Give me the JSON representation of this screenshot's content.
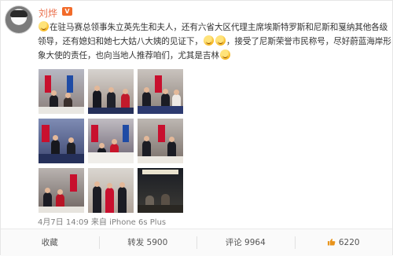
{
  "post": {
    "username": "刘烨",
    "vip_badge": "V",
    "content_lines": [
      "在驻马赛总领事朱立英先生和夫人，还有六省大区代理主席埃斯特罗斯和尼斯和戛纳其他各级",
      "领导，还有媳妇和她七大姑八大姨的见证下，",
      "，接受了尼斯荣誉市民称号，尽好蔚蓝海岸形",
      "象大使的责任，也向当地人推荐咱们，尤其是吉林"
    ],
    "timestamp": "4月7日 14:09 来自 iPhone 6s Plus",
    "photo_count": 9
  },
  "actions": {
    "favorite": "收藏",
    "repost": "转发 5900",
    "comment": "评论 9964",
    "like": "6220"
  },
  "colors": {
    "username": "#eb7350",
    "vip": "#f26b2a",
    "meta": "#808080"
  },
  "icons": {
    "emoji": "smile-emoji-icon",
    "like": "thumbs-up-icon",
    "vip": "vip-badge-icon"
  }
}
